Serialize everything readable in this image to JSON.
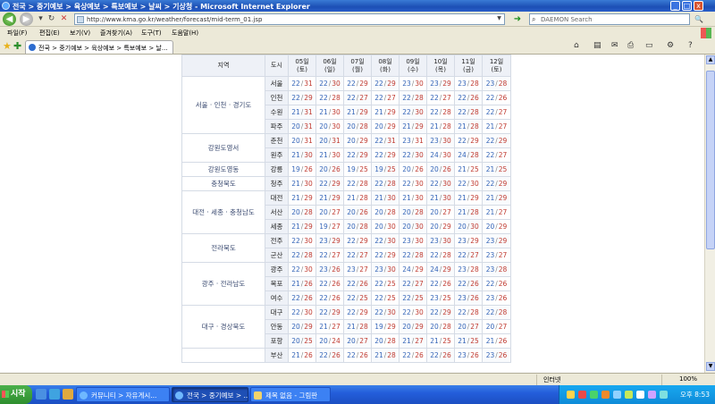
{
  "window": {
    "title": "전국 > 중기예보 > 육상예보 > 특보예보 > 날씨 > 기상청 - Microsoft Internet Explorer",
    "minimize": "_",
    "restore": "□",
    "close": "x"
  },
  "address": {
    "url": "http://www.kma.go.kr/weather/forecast/mid-term_01.jsp",
    "search_placeholder": "DAEMON Search"
  },
  "menu": [
    "파일(F)",
    "편집(E)",
    "보기(V)",
    "즐겨찾기(A)",
    "도구(T)",
    "도움말(H)"
  ],
  "tab": {
    "label": "전국 > 중기예보 > 육상예보 > 특보예보 > 날..."
  },
  "table": {
    "header": {
      "region": "지역",
      "city": "도시",
      "days": [
        {
          "date": "05일",
          "dow": "(토)"
        },
        {
          "date": "06일",
          "dow": "(일)"
        },
        {
          "date": "07일",
          "dow": "(월)"
        },
        {
          "date": "08일",
          "dow": "(화)"
        },
        {
          "date": "09일",
          "dow": "(수)"
        },
        {
          "date": "10일",
          "dow": "(목)"
        },
        {
          "date": "11일",
          "dow": "(금)"
        },
        {
          "date": "12일",
          "dow": "(토)"
        }
      ]
    },
    "groups": [
      {
        "region": "서울 · 인천 · 경기도",
        "rows": [
          {
            "city": "서울",
            "temps": [
              [
                22,
                31
              ],
              [
                22,
                30
              ],
              [
                22,
                29
              ],
              [
                22,
                29
              ],
              [
                23,
                30
              ],
              [
                23,
                29
              ],
              [
                23,
                28
              ],
              [
                23,
                28
              ]
            ]
          },
          {
            "city": "인천",
            "temps": [
              [
                22,
                29
              ],
              [
                22,
                28
              ],
              [
                22,
                27
              ],
              [
                22,
                27
              ],
              [
                22,
                28
              ],
              [
                22,
                27
              ],
              [
                22,
                26
              ],
              [
                22,
                26
              ]
            ]
          },
          {
            "city": "수원",
            "temps": [
              [
                21,
                31
              ],
              [
                21,
                30
              ],
              [
                21,
                29
              ],
              [
                21,
                29
              ],
              [
                22,
                30
              ],
              [
                22,
                28
              ],
              [
                22,
                28
              ],
              [
                22,
                27
              ]
            ]
          },
          {
            "city": "파주",
            "temps": [
              [
                20,
                31
              ],
              [
                20,
                30
              ],
              [
                20,
                28
              ],
              [
                20,
                29
              ],
              [
                21,
                29
              ],
              [
                21,
                28
              ],
              [
                21,
                28
              ],
              [
                21,
                27
              ]
            ]
          }
        ]
      },
      {
        "region": "강원도영서",
        "rows": [
          {
            "city": "춘천",
            "temps": [
              [
                20,
                31
              ],
              [
                20,
                31
              ],
              [
                20,
                29
              ],
              [
                22,
                31
              ],
              [
                23,
                31
              ],
              [
                23,
                30
              ],
              [
                22,
                29
              ],
              [
                22,
                29
              ]
            ]
          },
          {
            "city": "원주",
            "temps": [
              [
                21,
                30
              ],
              [
                21,
                30
              ],
              [
                22,
                29
              ],
              [
                22,
                29
              ],
              [
                22,
                30
              ],
              [
                24,
                30
              ],
              [
                24,
                28
              ],
              [
                22,
                27
              ]
            ]
          }
        ]
      },
      {
        "region": "강원도영동",
        "rows": [
          {
            "city": "강릉",
            "temps": [
              [
                19,
                26
              ],
              [
                20,
                26
              ],
              [
                19,
                25
              ],
              [
                19,
                25
              ],
              [
                20,
                26
              ],
              [
                20,
                26
              ],
              [
                21,
                25
              ],
              [
                21,
                25
              ]
            ]
          }
        ]
      },
      {
        "region": "충청북도",
        "rows": [
          {
            "city": "청주",
            "temps": [
              [
                21,
                30
              ],
              [
                22,
                29
              ],
              [
                22,
                28
              ],
              [
                22,
                28
              ],
              [
                22,
                30
              ],
              [
                22,
                30
              ],
              [
                22,
                30
              ],
              [
                22,
                29
              ]
            ]
          }
        ]
      },
      {
        "region": "대전 · 세종 · 충청남도",
        "rows": [
          {
            "city": "대전",
            "temps": [
              [
                21,
                29
              ],
              [
                21,
                29
              ],
              [
                21,
                28
              ],
              [
                21,
                30
              ],
              [
                21,
                30
              ],
              [
                21,
                30
              ],
              [
                21,
                29
              ],
              [
                21,
                29
              ]
            ]
          },
          {
            "city": "서산",
            "temps": [
              [
                20,
                28
              ],
              [
                20,
                27
              ],
              [
                20,
                26
              ],
              [
                20,
                28
              ],
              [
                20,
                28
              ],
              [
                20,
                27
              ],
              [
                21,
                28
              ],
              [
                21,
                27
              ]
            ]
          },
          {
            "city": "세종",
            "temps": [
              [
                21,
                29
              ],
              [
                19,
                27
              ],
              [
                20,
                28
              ],
              [
                20,
                30
              ],
              [
                20,
                30
              ],
              [
                20,
                29
              ],
              [
                20,
                30
              ],
              [
                20,
                29
              ]
            ]
          }
        ]
      },
      {
        "region": "전라북도",
        "rows": [
          {
            "city": "전주",
            "temps": [
              [
                22,
                30
              ],
              [
                23,
                29
              ],
              [
                22,
                29
              ],
              [
                22,
                30
              ],
              [
                23,
                30
              ],
              [
                23,
                30
              ],
              [
                23,
                29
              ],
              [
                23,
                29
              ]
            ]
          },
          {
            "city": "군산",
            "temps": [
              [
                22,
                28
              ],
              [
                22,
                27
              ],
              [
                22,
                27
              ],
              [
                22,
                29
              ],
              [
                22,
                28
              ],
              [
                22,
                28
              ],
              [
                22,
                27
              ],
              [
                23,
                27
              ]
            ]
          }
        ]
      },
      {
        "region": "광주 · 전라남도",
        "rows": [
          {
            "city": "광주",
            "temps": [
              [
                22,
                30
              ],
              [
                23,
                26
              ],
              [
                23,
                27
              ],
              [
                23,
                30
              ],
              [
                24,
                29
              ],
              [
                24,
                29
              ],
              [
                23,
                28
              ],
              [
                23,
                28
              ]
            ]
          },
          {
            "city": "목포",
            "temps": [
              [
                21,
                26
              ],
              [
                22,
                26
              ],
              [
                22,
                26
              ],
              [
                22,
                25
              ],
              [
                22,
                27
              ],
              [
                22,
                26
              ],
              [
                22,
                26
              ],
              [
                22,
                26
              ]
            ]
          },
          {
            "city": "여수",
            "temps": [
              [
                22,
                26
              ],
              [
                22,
                26
              ],
              [
                22,
                25
              ],
              [
                22,
                25
              ],
              [
                22,
                25
              ],
              [
                23,
                25
              ],
              [
                23,
                26
              ],
              [
                23,
                26
              ]
            ]
          }
        ]
      },
      {
        "region": "대구 · 경상북도",
        "rows": [
          {
            "city": "대구",
            "temps": [
              [
                22,
                30
              ],
              [
                22,
                29
              ],
              [
                22,
                29
              ],
              [
                22,
                30
              ],
              [
                22,
                30
              ],
              [
                22,
                29
              ],
              [
                22,
                28
              ],
              [
                22,
                28
              ]
            ]
          },
          {
            "city": "안동",
            "temps": [
              [
                20,
                29
              ],
              [
                21,
                27
              ],
              [
                21,
                28
              ],
              [
                19,
                29
              ],
              [
                20,
                29
              ],
              [
                20,
                28
              ],
              [
                20,
                27
              ],
              [
                20,
                27
              ]
            ]
          },
          {
            "city": "포항",
            "temps": [
              [
                20,
                25
              ],
              [
                20,
                24
              ],
              [
                20,
                27
              ],
              [
                20,
                28
              ],
              [
                21,
                27
              ],
              [
                21,
                25
              ],
              [
                21,
                25
              ],
              [
                21,
                26
              ]
            ]
          }
        ]
      },
      {
        "region": "",
        "rows": [
          {
            "city": "부산",
            "temps": [
              [
                21,
                26
              ],
              [
                22,
                26
              ],
              [
                22,
                26
              ],
              [
                21,
                28
              ],
              [
                22,
                26
              ],
              [
                22,
                26
              ],
              [
                23,
                26
              ],
              [
                23,
                26
              ]
            ]
          }
        ]
      }
    ]
  },
  "status": {
    "zone": "인터넷",
    "zoom": "100%"
  },
  "taskbar": {
    "start": "시작",
    "buttons": [
      {
        "label": "커뮤니티 > 자유게시...",
        "active": false
      },
      {
        "label": "전국 > 중기예보 > ...",
        "active": true
      },
      {
        "label": "제목 없음 - 그림판",
        "active": false
      }
    ],
    "clock": "오후 8:53"
  },
  "colors": {
    "low_temp": "#3565b8",
    "high_temp": "#c03a30",
    "header_bg": "#eef1f7",
    "taskbar": "#245edb",
    "start": "#2e8e2e"
  }
}
